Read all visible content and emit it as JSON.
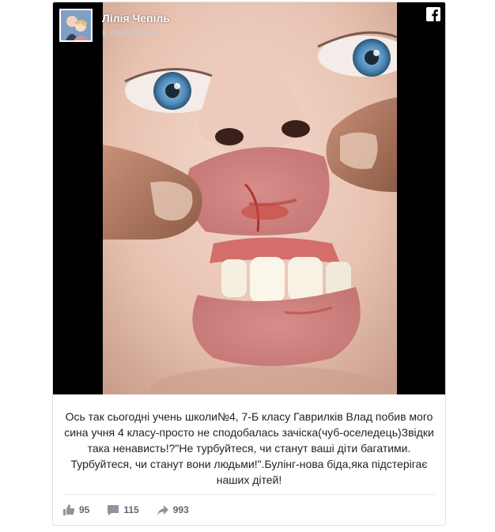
{
  "post": {
    "author": "Лілія Чепіль",
    "timestamp": "в понеділник",
    "caption": "Ось так сьогодні учень школи№4, 7-Б класу Гаврилків Влад побив мого сина учня 4 класу-просто не сподобалась зачіска(чуб-оселедець)Звідки така ненависть!?\"Не турбуйтеся, чи станут ваші діти багатими. Турбуйтеся, чи станут вони людьми!\".Булінг-нова біда,яка підстерігає наших дітей!"
  },
  "reactions": {
    "likes": "95",
    "comments": "115",
    "shares": "993"
  },
  "icons": {
    "platform_logo": "facebook-icon",
    "like": "thumbs-up-icon",
    "comment": "comment-bubble-icon",
    "share": "share-arrow-icon"
  },
  "colors": {
    "media_background": "#000000",
    "text": "#1d2129",
    "secondary_text": "#606770",
    "border": "#dddfe2"
  }
}
